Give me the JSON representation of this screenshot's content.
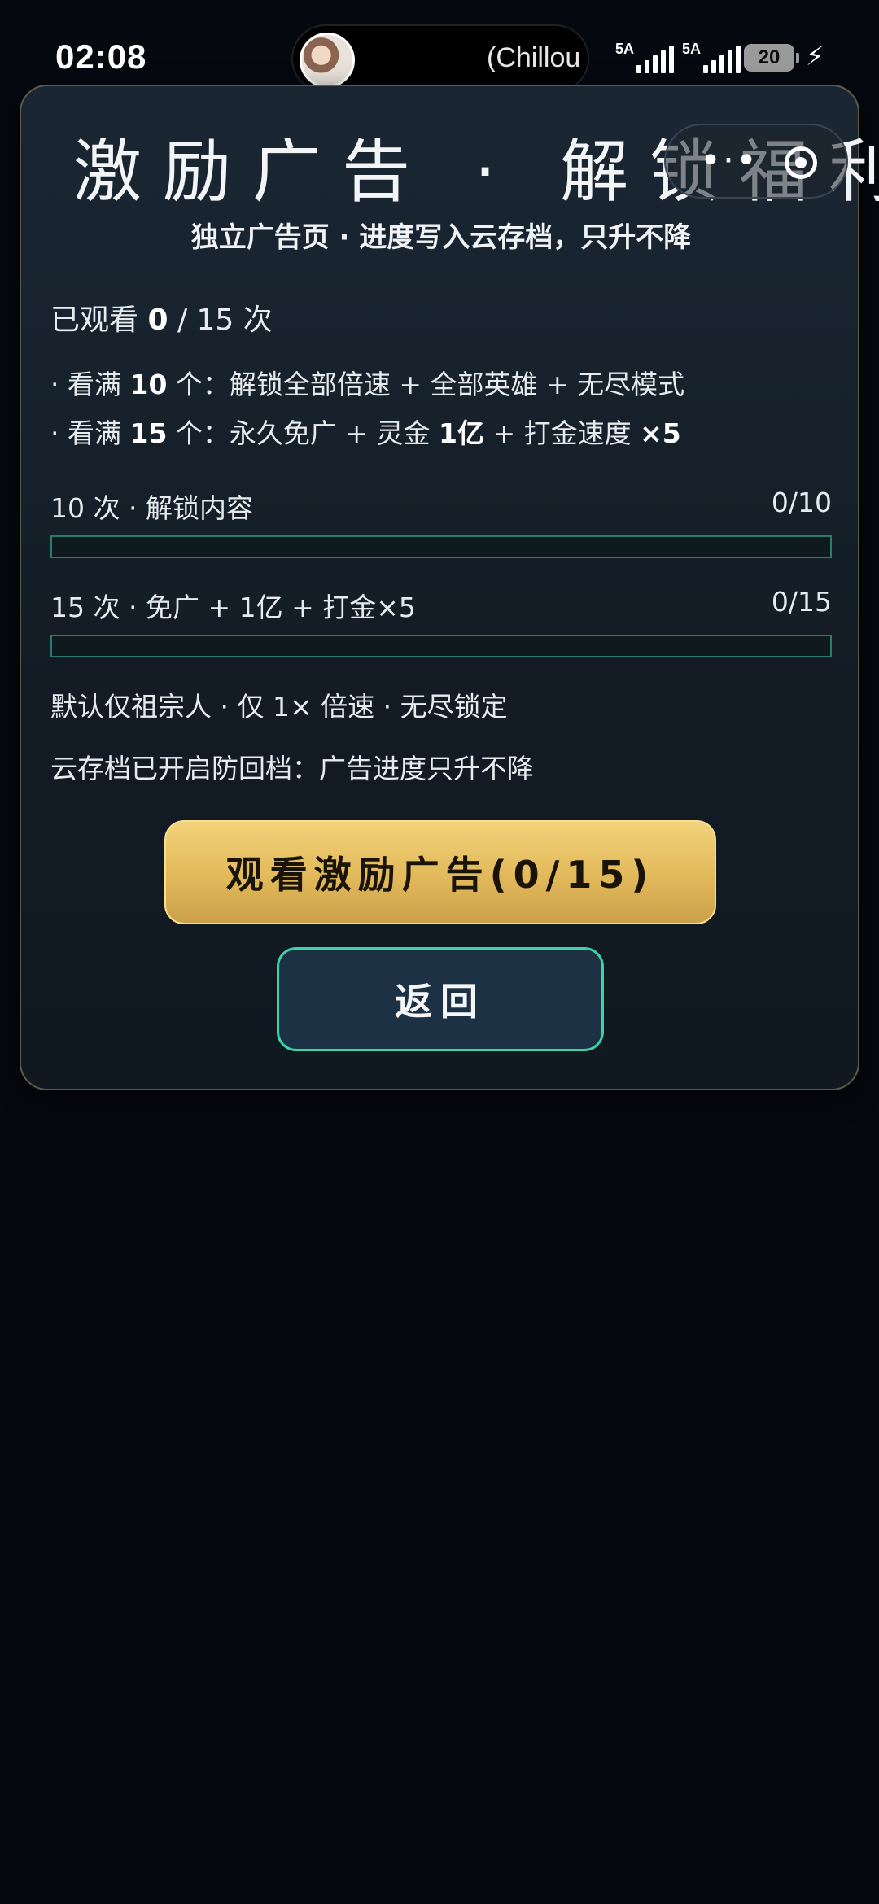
{
  "status_bar": {
    "time": "02:08",
    "media_title": "(Chillou",
    "sim1_label": "5A",
    "sim2_label": "5A",
    "battery": "20",
    "charging_icon": "lightning-icon"
  },
  "card": {
    "title": "激励广告 · 解锁福利",
    "capsule_menu": "•·•",
    "subtitle": "独立广告页 · 进度写入云存档，只升不降",
    "watched_prefix": "已观看 ",
    "watched_count": "0",
    "watched_suffix": " / 15 次",
    "reward_1": {
      "pre": "· 看满 ",
      "num": "10",
      "post": " 个：解锁全部倍速 + 全部英雄 + 无尽模式"
    },
    "reward_2": {
      "pre": "· 看满 ",
      "num": "15",
      "post": " 个：永久免广 + 灵金 ",
      "num2": "1亿",
      "post2": " + 打金速度 ",
      "num3": "×5"
    },
    "progress": [
      {
        "label": "10 次 · 解锁内容",
        "value": "0/10",
        "fraction": 0
      },
      {
        "label": "15 次 · 免广 + 1亿 + 打金×5",
        "value": "0/15",
        "fraction": 0
      }
    ],
    "note_1": "默认仅祖宗人 · 仅 1× 倍速 · 无尽锁定",
    "note_2": "云存档已开启防回档：广告进度只升不降",
    "watch_button": "观看激励广告(0/15)",
    "back_button": "返回"
  },
  "colors": {
    "background": "#05080f",
    "card": "#16212c",
    "gold": "#e2b95a",
    "teal": "#3cd3a6"
  }
}
